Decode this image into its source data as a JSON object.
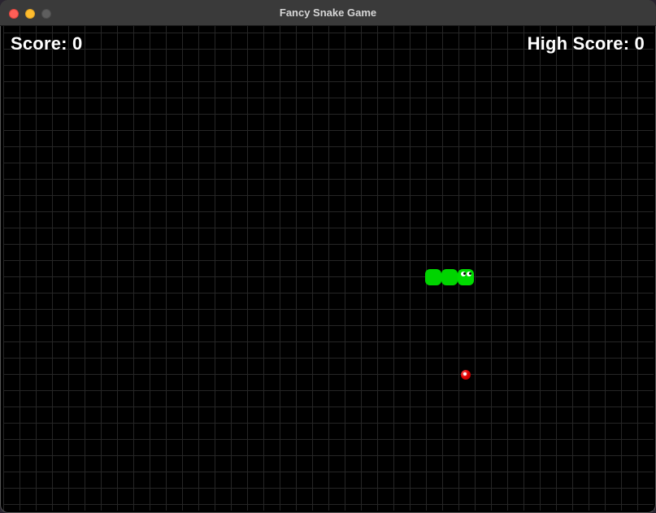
{
  "window": {
    "title": "Fancy Snake Game"
  },
  "hud": {
    "score_label": "Score: 0",
    "high_score_label": "High Score: 0"
  },
  "game": {
    "score": 0,
    "high_score": 0,
    "direction": "right",
    "snake_color": "#00d400",
    "food_color": "#e00000",
    "grid_color": "#262626",
    "background_color": "#000000"
  },
  "icons": {
    "close": "close-icon",
    "minimize": "minimize-icon",
    "zoom": "zoom-icon",
    "food": "apple-icon"
  }
}
